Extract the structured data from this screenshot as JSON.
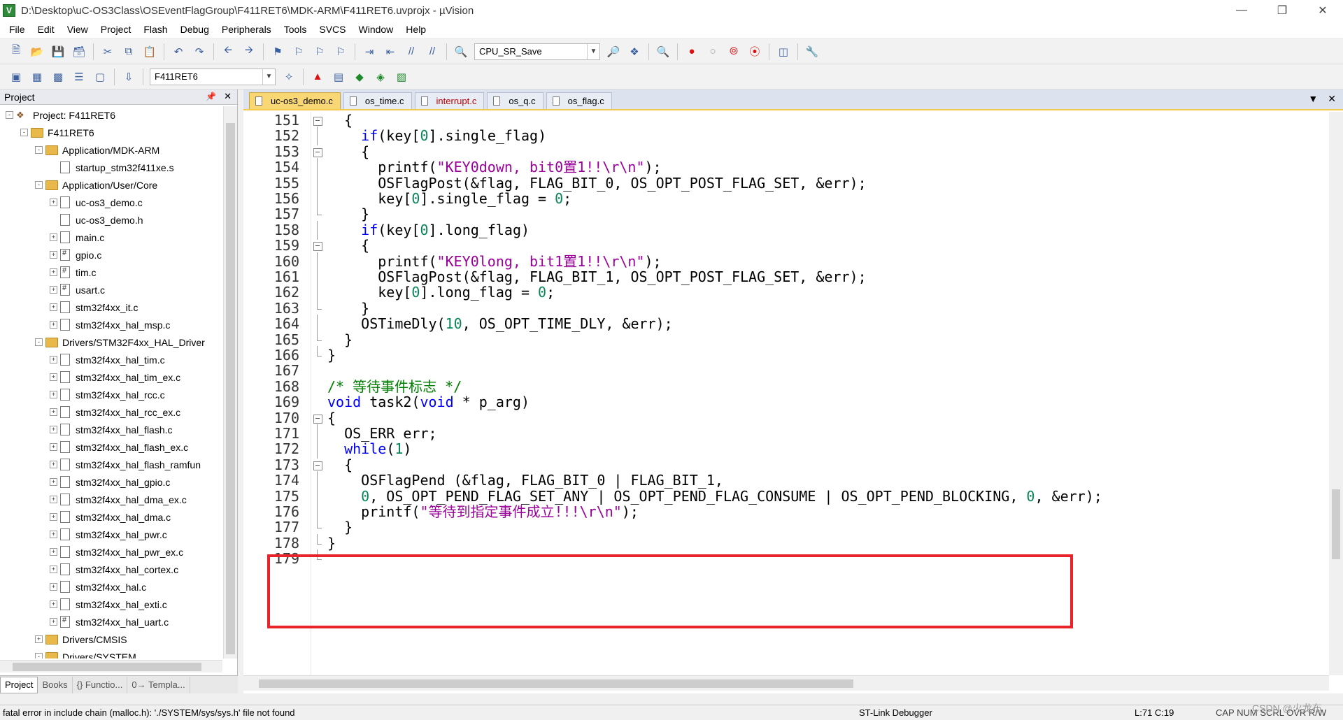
{
  "window": {
    "title": "D:\\Desktop\\uC-OS3Class\\OSEventFlagGroup\\F411RET6\\MDK-ARM\\F411RET6.uvprojx - µVision",
    "app_icon_letter": "V"
  },
  "menu": [
    "File",
    "Edit",
    "View",
    "Project",
    "Flash",
    "Debug",
    "Peripherals",
    "Tools",
    "SVCS",
    "Window",
    "Help"
  ],
  "toolbar1": {
    "find_combo": "CPU_SR_Save"
  },
  "toolbar2": {
    "target_combo": "F411RET6"
  },
  "project_panel": {
    "title": "Project",
    "tree": [
      {
        "level": 0,
        "toggle": "-",
        "icon": "project",
        "label": "Project: F411RET6"
      },
      {
        "level": 1,
        "toggle": "-",
        "icon": "folder",
        "label": "F411RET6"
      },
      {
        "level": 2,
        "toggle": "-",
        "icon": "folder",
        "label": "Application/MDK-ARM"
      },
      {
        "level": 3,
        "toggle": "",
        "icon": "file",
        "label": "startup_stm32f411xe.s"
      },
      {
        "level": 2,
        "toggle": "-",
        "icon": "folder",
        "label": "Application/User/Core"
      },
      {
        "level": 3,
        "toggle": "+",
        "icon": "file",
        "label": "uc-os3_demo.c"
      },
      {
        "level": 3,
        "toggle": "",
        "icon": "file",
        "label": "uc-os3_demo.h"
      },
      {
        "level": 3,
        "toggle": "+",
        "icon": "file",
        "label": "main.c"
      },
      {
        "level": 3,
        "toggle": "+",
        "icon": "hdr",
        "label": "gpio.c"
      },
      {
        "level": 3,
        "toggle": "+",
        "icon": "hdr",
        "label": "tim.c"
      },
      {
        "level": 3,
        "toggle": "+",
        "icon": "hdr",
        "label": "usart.c"
      },
      {
        "level": 3,
        "toggle": "+",
        "icon": "file",
        "label": "stm32f4xx_it.c"
      },
      {
        "level": 3,
        "toggle": "+",
        "icon": "file",
        "label": "stm32f4xx_hal_msp.c"
      },
      {
        "level": 2,
        "toggle": "-",
        "icon": "folder",
        "label": "Drivers/STM32F4xx_HAL_Driver"
      },
      {
        "level": 3,
        "toggle": "+",
        "icon": "file",
        "label": "stm32f4xx_hal_tim.c"
      },
      {
        "level": 3,
        "toggle": "+",
        "icon": "file",
        "label": "stm32f4xx_hal_tim_ex.c"
      },
      {
        "level": 3,
        "toggle": "+",
        "icon": "file",
        "label": "stm32f4xx_hal_rcc.c"
      },
      {
        "level": 3,
        "toggle": "+",
        "icon": "file",
        "label": "stm32f4xx_hal_rcc_ex.c"
      },
      {
        "level": 3,
        "toggle": "+",
        "icon": "file",
        "label": "stm32f4xx_hal_flash.c"
      },
      {
        "level": 3,
        "toggle": "+",
        "icon": "file",
        "label": "stm32f4xx_hal_flash_ex.c"
      },
      {
        "level": 3,
        "toggle": "+",
        "icon": "file",
        "label": "stm32f4xx_hal_flash_ramfun"
      },
      {
        "level": 3,
        "toggle": "+",
        "icon": "file",
        "label": "stm32f4xx_hal_gpio.c"
      },
      {
        "level": 3,
        "toggle": "+",
        "icon": "file",
        "label": "stm32f4xx_hal_dma_ex.c"
      },
      {
        "level": 3,
        "toggle": "+",
        "icon": "file",
        "label": "stm32f4xx_hal_dma.c"
      },
      {
        "level": 3,
        "toggle": "+",
        "icon": "file",
        "label": "stm32f4xx_hal_pwr.c"
      },
      {
        "level": 3,
        "toggle": "+",
        "icon": "file",
        "label": "stm32f4xx_hal_pwr_ex.c"
      },
      {
        "level": 3,
        "toggle": "+",
        "icon": "file",
        "label": "stm32f4xx_hal_cortex.c"
      },
      {
        "level": 3,
        "toggle": "+",
        "icon": "file",
        "label": "stm32f4xx_hal.c"
      },
      {
        "level": 3,
        "toggle": "+",
        "icon": "file",
        "label": "stm32f4xx_hal_exti.c"
      },
      {
        "level": 3,
        "toggle": "+",
        "icon": "hdr",
        "label": "stm32f4xx_hal_uart.c"
      },
      {
        "level": 2,
        "toggle": "+",
        "icon": "folder",
        "label": "Drivers/CMSIS"
      },
      {
        "level": 2,
        "toggle": "-",
        "icon": "folder",
        "label": "Drivers/SYSTEM"
      }
    ],
    "bottom_tabs": [
      "Project",
      "Books",
      "{} Functio...",
      "0→ Templa..."
    ]
  },
  "editor": {
    "tabs": [
      "uc-os3_demo.c",
      "os_time.c",
      "interrupt.c",
      "os_q.c",
      "os_flag.c"
    ],
    "active_tab": 0,
    "lines": [
      {
        "n": "151",
        "fold": "box",
        "html": "  {"
      },
      {
        "n": "152",
        "fold": "line",
        "html": "    <span class='kw'>if</span>(key[<span class='num'>0</span>].single_flag)"
      },
      {
        "n": "153",
        "fold": "box",
        "html": "    {"
      },
      {
        "n": "154",
        "fold": "line",
        "html": "      printf(<span class='str2'>\"KEY0down, bit0置1!!\\r\\n\"</span>);"
      },
      {
        "n": "155",
        "fold": "line",
        "html": "      OSFlagPost(&amp;flag, FLAG_BIT_0, OS_OPT_POST_FLAG_SET, &amp;err);"
      },
      {
        "n": "156",
        "fold": "line",
        "html": "      key[<span class='num'>0</span>].single_flag = <span class='num'>0</span>;"
      },
      {
        "n": "157",
        "fold": "end",
        "html": "    }"
      },
      {
        "n": "158",
        "fold": "line",
        "html": "    <span class='kw'>if</span>(key[<span class='num'>0</span>].long_flag)"
      },
      {
        "n": "159",
        "fold": "box",
        "html": "    {"
      },
      {
        "n": "160",
        "fold": "line",
        "html": "      printf(<span class='str2'>\"KEY0long, bit1置1!!\\r\\n\"</span>);"
      },
      {
        "n": "161",
        "fold": "line",
        "html": "      OSFlagPost(&amp;flag, FLAG_BIT_1, OS_OPT_POST_FLAG_SET, &amp;err);"
      },
      {
        "n": "162",
        "fold": "line",
        "html": "      key[<span class='num'>0</span>].long_flag = <span class='num'>0</span>;"
      },
      {
        "n": "163",
        "fold": "end",
        "html": "    }"
      },
      {
        "n": "164",
        "fold": "line",
        "html": "    OSTimeDly(<span class='num'>10</span>, OS_OPT_TIME_DLY, &amp;err);"
      },
      {
        "n": "165",
        "fold": "end",
        "html": "  }"
      },
      {
        "n": "166",
        "fold": "end",
        "html": "}"
      },
      {
        "n": "167",
        "fold": "",
        "html": ""
      },
      {
        "n": "168",
        "fold": "",
        "html": "<span class='cmt'>/* 等待事件标志 */</span>"
      },
      {
        "n": "169",
        "fold": "",
        "html": "<span class='kw'>void</span> task2(<span class='kw'>void</span> * p_arg)"
      },
      {
        "n": "170",
        "fold": "box",
        "html": "{"
      },
      {
        "n": "171",
        "fold": "line",
        "html": "  OS_ERR err;"
      },
      {
        "n": "172",
        "fold": "line",
        "html": "  <span class='kw'>while</span>(<span class='num'>1</span>)"
      },
      {
        "n": "173",
        "fold": "box",
        "html": "  {"
      },
      {
        "n": "174",
        "fold": "line",
        "html": "    OSFlagPend (&amp;flag, FLAG_BIT_0 | FLAG_BIT_1,"
      },
      {
        "n": "175",
        "fold": "line",
        "html": "    <span class='num'>0</span>, OS_OPT_PEND_FLAG_SET_ANY | OS_OPT_PEND_FLAG_CONSUME | OS_OPT_PEND_BLOCKING, <span class='num'>0</span>, &amp;err);"
      },
      {
        "n": "176",
        "fold": "line",
        "html": "    printf(<span class='str2'>\"等待到指定事件成立!!!\\r\\n\"</span>);"
      },
      {
        "n": "177",
        "fold": "end",
        "html": "  }"
      },
      {
        "n": "178",
        "fold": "end",
        "html": "}"
      },
      {
        "n": "179",
        "fold": "end",
        "html": ""
      }
    ]
  },
  "statusbar": {
    "message": "fatal error in include chain (malloc.h): './SYSTEM/sys/sys.h' file not found",
    "debugger": "ST-Link Debugger",
    "position": "L:71 C:19",
    "indicators": "CAP  NUM  SCRL  OVR  R/W",
    "watermark": "CSDN @火龙布"
  }
}
